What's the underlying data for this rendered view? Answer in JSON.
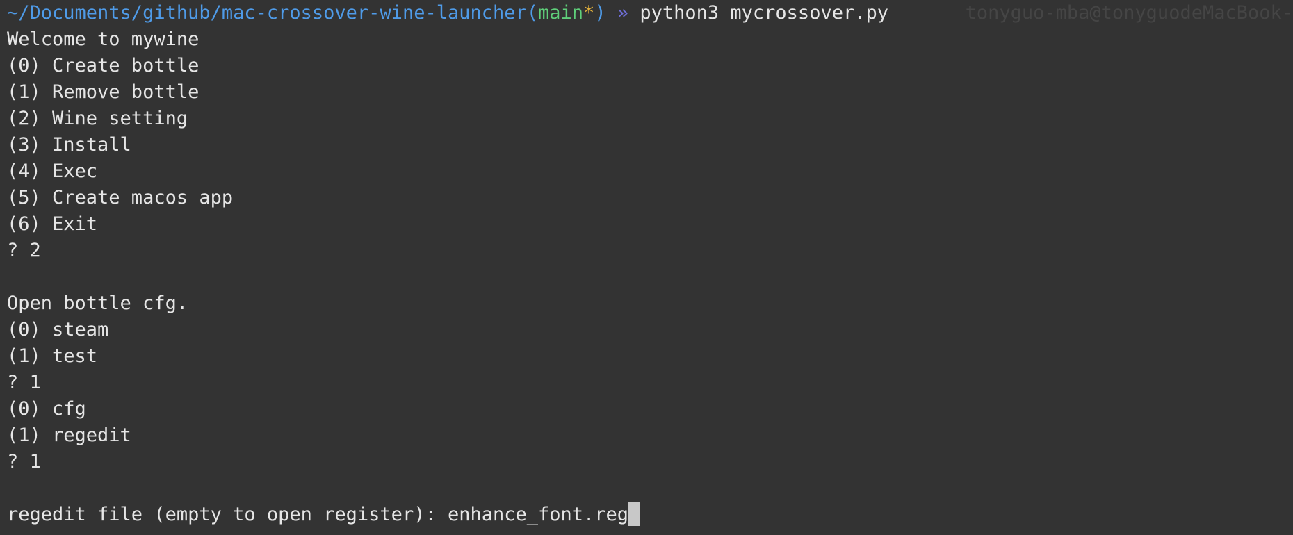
{
  "prompt": {
    "path": "~/Documents/github/mac-crossover-wine-launcher",
    "paren_open": "(",
    "branch": "main",
    "dirty_marker": "*",
    "paren_close": ")",
    "arrow": " » ",
    "command": "python3 mycrossover.py",
    "host": "tonyguo-mba@tonyguodeMacBook-"
  },
  "output": {
    "welcome": "Welcome to mywine",
    "main_menu": [
      "(0) Create bottle",
      "(1) Remove bottle",
      "(2) Wine setting",
      "(3) Install",
      "(4) Exec",
      "(5) Create macos app",
      "(6) Exit"
    ],
    "answer_1": "? 2",
    "blank_1": "",
    "open_bottle_cfg": "Open bottle cfg.",
    "bottle_menu": [
      "(0) steam",
      "(1) test"
    ],
    "answer_2": "? 1",
    "cfg_menu": [
      "(0) cfg",
      "(1) regedit"
    ],
    "answer_3": "? 1",
    "blank_2": "",
    "regedit_prompt": "regedit file (empty to open register): ",
    "regedit_input": "enhance_font.reg"
  },
  "colors": {
    "background": "#333333",
    "text": "#e6e6e6",
    "path": "#4f9be8",
    "branch": "#5fcf7a",
    "dirty_marker": "#e6b43c",
    "arrow": "#6f6fd8"
  }
}
